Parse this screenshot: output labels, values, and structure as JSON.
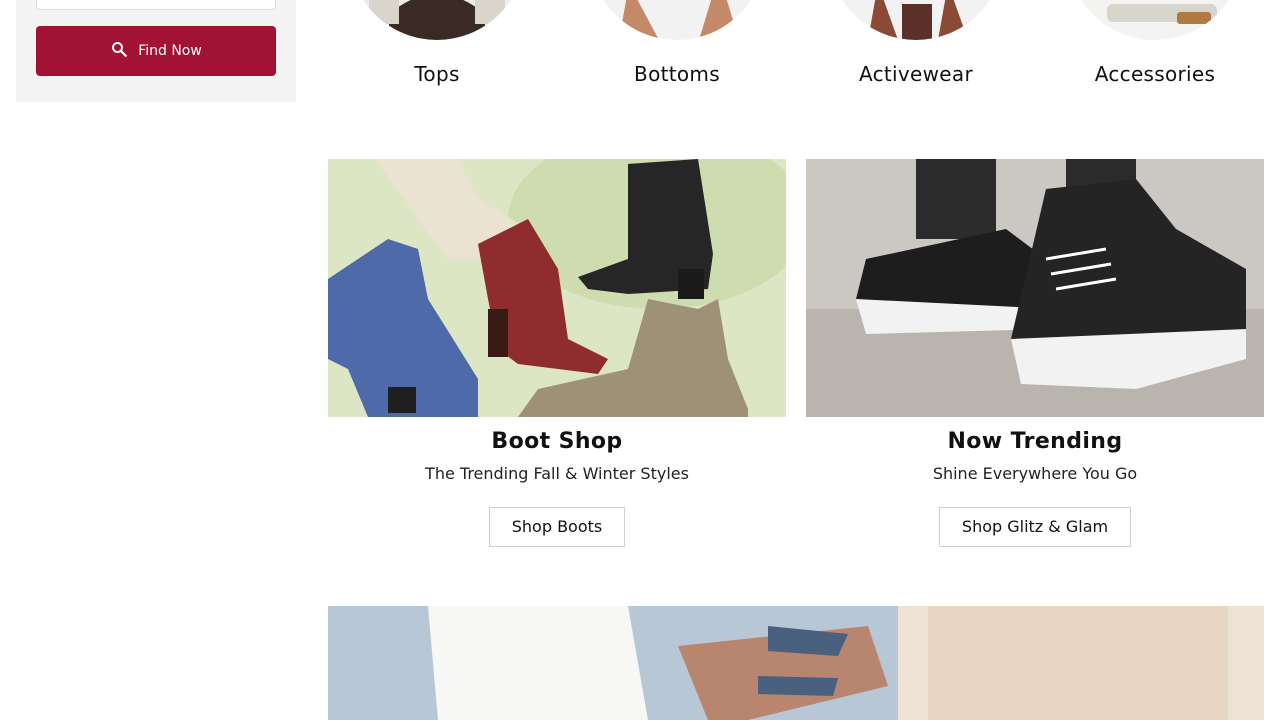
{
  "sidebar": {
    "find_button_label": "Find Now",
    "find_icon": "search-icon",
    "accent_color": "#a11234"
  },
  "categories": [
    {
      "label": "Tops"
    },
    {
      "label": "Bottoms"
    },
    {
      "label": "Activewear"
    },
    {
      "label": "Accessories"
    }
  ],
  "promos": [
    {
      "title": "Boot Shop",
      "subtitle": "The Trending Fall & Winter Styles",
      "button_label": "Shop Boots"
    },
    {
      "title": "Now Trending",
      "subtitle": "Shine Everywhere You Go",
      "button_label": "Shop Glitz & Glam"
    }
  ]
}
